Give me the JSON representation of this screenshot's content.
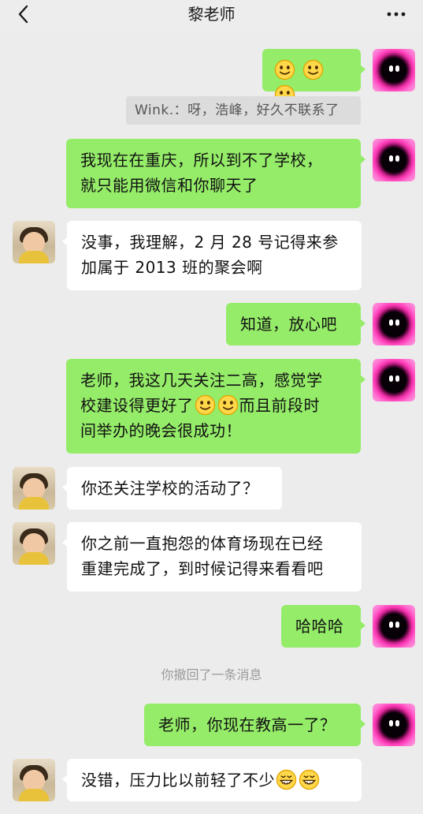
{
  "header": {
    "title": "黎老师",
    "back_icon": "chevron-left-icon",
    "more_icon": "more-horizontal-icon"
  },
  "messages": [
    {
      "sender": "me",
      "text": "",
      "emojis": [
        "smile-emoji",
        "smile-emoji",
        "smile-emoji"
      ]
    },
    {
      "sender": "quote",
      "text": "Wink.：呀，浩峰，好久不联系了"
    },
    {
      "sender": "me",
      "lines": [
        "我现在在重庆，所以到不了学校，",
        "就只能用微信和你聊天了"
      ]
    },
    {
      "sender": "other",
      "lines": [
        "没事，我理解，2 月 28 号记得来参",
        "加属于 2013 班的聚会啊"
      ]
    },
    {
      "sender": "me",
      "lines": [
        "知道，放心吧"
      ]
    },
    {
      "sender": "me",
      "lines": [
        "老师，我这几天关注二高，感觉学",
        "校建设得更好了",
        "而且前段时",
        "间举办的晚会很成功！"
      ]
    },
    {
      "sender": "other",
      "lines": [
        "你还关注学校的活动了？"
      ]
    },
    {
      "sender": "other",
      "lines": [
        "你之前一直抱怨的体育场现在已经",
        "重建完成了，到时候记得来看看吧"
      ]
    },
    {
      "sender": "me",
      "lines": [
        "哈哈哈"
      ]
    },
    {
      "sender": "system",
      "text": "你撤回了一条消息"
    },
    {
      "sender": "me",
      "lines": [
        "老师，你现在教高一了？"
      ]
    },
    {
      "sender": "other",
      "lines": [
        "没错，压力比以前轻了不少"
      ]
    }
  ],
  "colors": {
    "background": "#ececec",
    "my_bubble": "#95ec69",
    "other_bubble": "#ffffff",
    "quote_bg": "#dcdcdc"
  }
}
